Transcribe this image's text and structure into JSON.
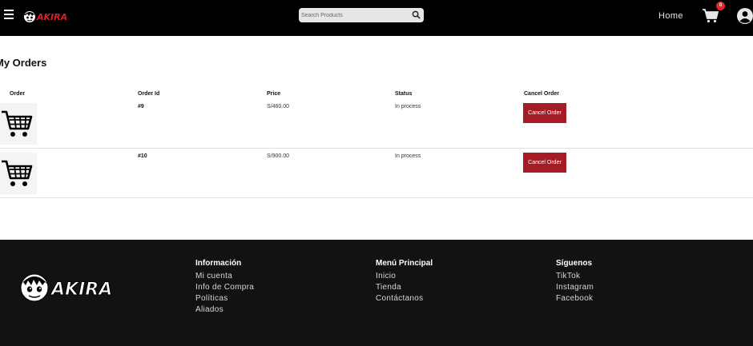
{
  "header": {
    "brand": "AKIRA",
    "search_placeholder": "Search Products",
    "nav_home": "Home",
    "cart_count": "0"
  },
  "page": {
    "title": "My Orders"
  },
  "table": {
    "columns": [
      "Order",
      "Order Id",
      "Price",
      "Status",
      "Cancel Order"
    ],
    "rows": [
      {
        "id": "#9",
        "price": "S/460.00",
        "status": "In process",
        "action": "Cancel Order"
      },
      {
        "id": "#10",
        "price": "S/900.00",
        "status": "In process",
        "action": "Cancel Order"
      }
    ]
  },
  "footer": {
    "brand": "AKIRA",
    "columns": [
      {
        "title": "Información",
        "links": [
          "Mi cuenta",
          "Info de Compra",
          "Políticas",
          "Aliados"
        ]
      },
      {
        "title": "Menú Principal",
        "links": [
          "Inicio",
          "Tienda",
          "Contáctanos"
        ]
      },
      {
        "title": "Síguenos",
        "links": [
          "TikTok",
          "Instagram",
          "Facebook"
        ]
      }
    ]
  },
  "colors": {
    "header_bg": "#000000",
    "footer_bg": "#121212",
    "cancel_button": "#a51c24",
    "badge": "#e0262e",
    "brand_red": "#d6222a"
  }
}
